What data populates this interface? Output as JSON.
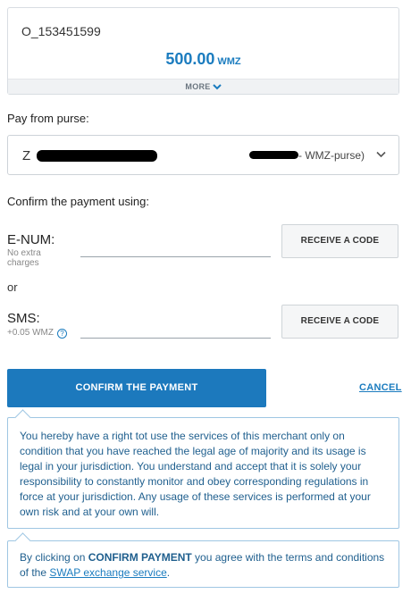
{
  "order": {
    "id": "O_153451599",
    "amount": "500.00",
    "currency": "WMZ",
    "more_label": "MORE"
  },
  "pay_from": {
    "label": "Pay from purse:",
    "purse_prefix": "Z",
    "purse_type": "- WMZ-purse)"
  },
  "confirm_using": {
    "label": "Confirm the payment using:",
    "enum": {
      "label": "E-NUM:",
      "note": "No extra charges",
      "button": "RECEIVE A CODE"
    },
    "or_label": "or",
    "sms": {
      "label": "SMS:",
      "note": "+0.05 WMZ",
      "help": "?",
      "button": "RECEIVE A CODE"
    }
  },
  "actions": {
    "confirm": "CONFIRM THE PAYMENT",
    "cancel": "CANCEL"
  },
  "notices": {
    "legal_text": "You hereby have a right tot use the services of this merchant only on condition that you have reached the legal age of majority and its usage is legal in your jurisdiction. You understand and accept that it is solely your responsibility to constantly monitor and obey corresponding regulations in force at your jurisdiction. Any usage of these services is performed at your own risk and at your own will.",
    "terms_prefix": "By clicking on ",
    "terms_bold": "CONFIRM PAYMENT",
    "terms_middle": " you agree with the terms and conditions of the ",
    "terms_link": "SWAP exchange service",
    "terms_suffix": "."
  },
  "colors": {
    "accent": "#1c79bd",
    "info_text": "#1f5f8e",
    "info_border": "#9fc6e3"
  },
  "icons": [
    "chevron-down-icon",
    "help-icon"
  ]
}
